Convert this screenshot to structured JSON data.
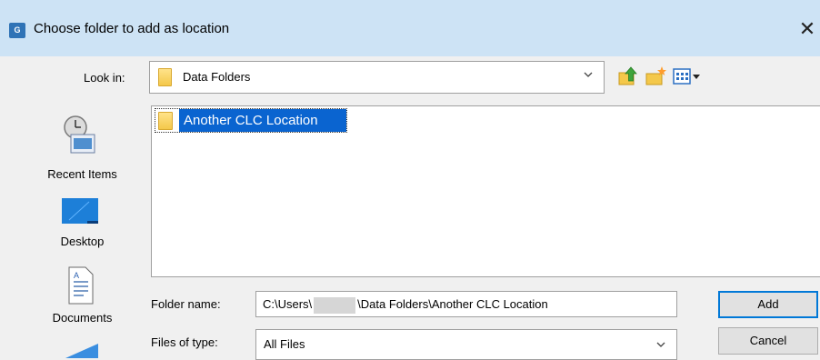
{
  "window": {
    "title": "Choose folder to add as location",
    "app_icon_text": "G",
    "close_glyph": "✕"
  },
  "lookin": {
    "label": "Look in:",
    "value": "Data Folders"
  },
  "toolbar": {
    "icons": [
      "up-one-level-icon",
      "create-new-folder-icon",
      "view-menu-icon"
    ]
  },
  "places": [
    {
      "label": "Recent Items",
      "icon": "recent-items-icon"
    },
    {
      "label": "Desktop",
      "icon": "desktop-icon"
    },
    {
      "label": "Documents",
      "icon": "documents-icon"
    }
  ],
  "files": [
    {
      "name": "Another CLC Location",
      "selected": true
    }
  ],
  "folder_name": {
    "label": "Folder name:",
    "value_prefix": "C:\\Users\\",
    "value_suffix": "\\Data Folders\\Another CLC Location"
  },
  "files_of_type": {
    "label": "Files of type:",
    "value": "All Files"
  },
  "buttons": {
    "add": "Add",
    "cancel": "Cancel"
  },
  "colors": {
    "titlebar": "#cde3f5",
    "selection": "#0a64d0",
    "accent": "#0078d7"
  }
}
